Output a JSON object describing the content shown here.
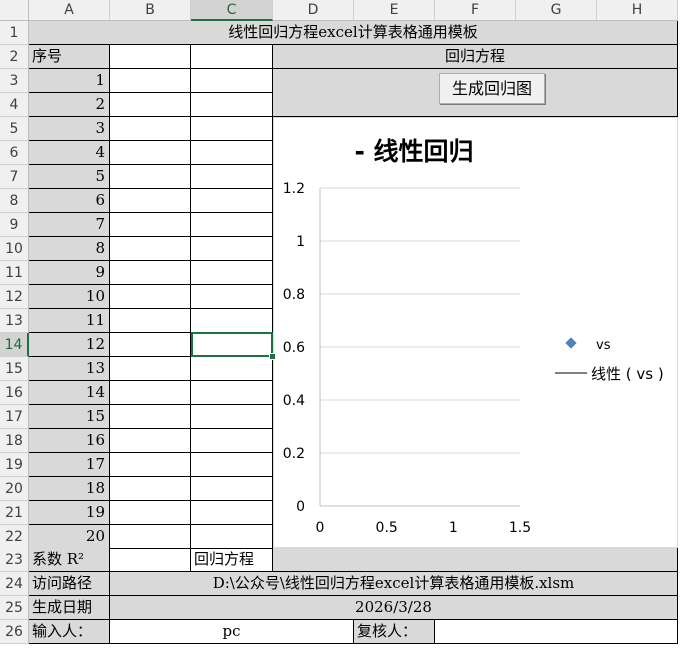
{
  "sheet": {
    "column_headers": [
      "A",
      "B",
      "C",
      "D",
      "E",
      "F",
      "G",
      "H"
    ],
    "row_headers": [
      "1",
      "2",
      "3",
      "4",
      "5",
      "6",
      "7",
      "8",
      "9",
      "10",
      "11",
      "12",
      "13",
      "14",
      "15",
      "16",
      "17",
      "18",
      "19",
      "20",
      "21",
      "22",
      "23",
      "24",
      "25",
      "26"
    ],
    "selected_cell": "C14",
    "title": "线性回归方程excel计算表格通用模板",
    "index_header": "序号",
    "formula_header": "回归方程",
    "index_values": [
      "1",
      "2",
      "3",
      "4",
      "5",
      "6",
      "7",
      "8",
      "9",
      "10",
      "11",
      "12",
      "13",
      "14",
      "15",
      "16",
      "17",
      "18",
      "19",
      "20"
    ],
    "coef_label": "系数 R²",
    "regression_label": "回归方程",
    "path_label": "访问路径",
    "path_value": "D:\\公众号\\线性回归方程excel计算表格通用模板.xlsm",
    "date_label": "生成日期",
    "date_value": "2026/3/28",
    "input_label": "输入人：",
    "input_value": "pc",
    "reviewer_label": "复核人："
  },
  "button": {
    "label": "生成回归图"
  },
  "chart_data": {
    "type": "scatter",
    "title": "- 线性回归",
    "xlim": [
      0,
      1.5
    ],
    "ylim": [
      0,
      1.2
    ],
    "x_ticks": [
      "0",
      "0.5",
      "1",
      "1.5"
    ],
    "y_ticks": [
      "0",
      "0.2",
      "0.4",
      "0.6",
      "0.8",
      "1",
      "1.2"
    ],
    "grid": true,
    "legend_position": "right",
    "series": [
      {
        "name": "vs",
        "marker": "diamond",
        "color": "#4f81bd",
        "values": []
      },
      {
        "name": "线性 ( vs )",
        "marker": "line",
        "color": "#000000",
        "values": []
      }
    ]
  }
}
